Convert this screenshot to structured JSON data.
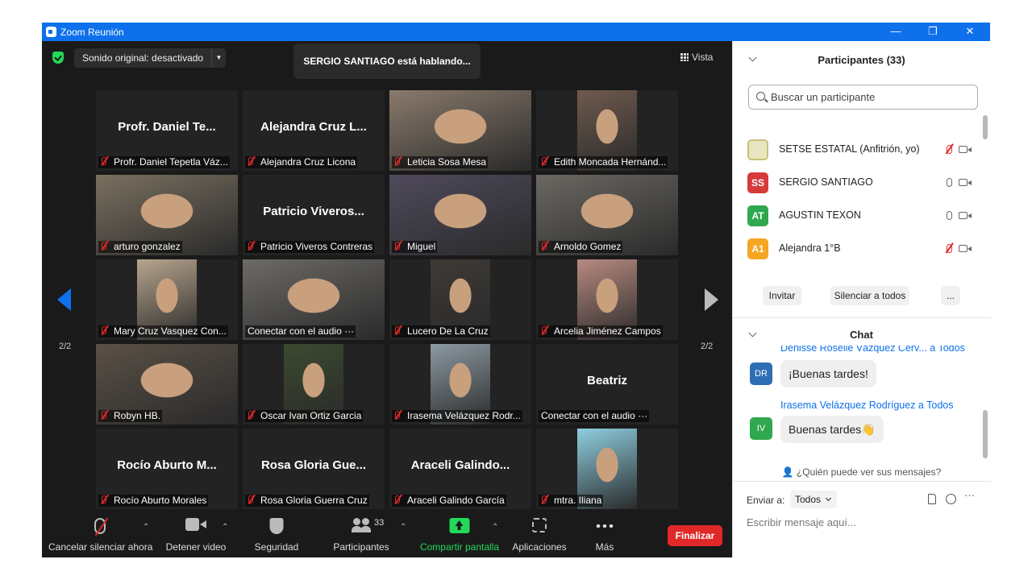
{
  "window": {
    "title": "Zoom Reunión",
    "controls": {
      "minimize": "—",
      "restore": "❐",
      "close": "✕"
    }
  },
  "meeting": {
    "sound_button": "Sonido original: desactivado",
    "speaking_banner": "SERGIO SANTIAGO está hablando...",
    "view_button": "Vista",
    "page_indicator_left": "2/2",
    "page_indicator_right": "2/2",
    "tiles": [
      {
        "big": "Profr. Daniel Te...",
        "name": "Profr. Daniel Tepetla Váz...",
        "muted": true,
        "video": false
      },
      {
        "big": "Alejandra Cruz L...",
        "name": "Alejandra Cruz Licona",
        "muted": true,
        "video": false
      },
      {
        "big": "",
        "name": "Leticia Sosa Mesa",
        "muted": true,
        "video": true,
        "tone": "#8a7a6c"
      },
      {
        "big": "",
        "name": "Edith Moncada Hernánd...",
        "muted": true,
        "video": true,
        "tone": "#6f5a4e"
      },
      {
        "big": "",
        "name": "arturo gonzalez",
        "muted": true,
        "video": true,
        "tone": "#7a7060"
      },
      {
        "big": "Patricio  Viveros...",
        "name": "Patricio Viveros Contreras",
        "muted": true,
        "video": false
      },
      {
        "big": "",
        "name": "Miguel",
        "muted": true,
        "video": true,
        "tone": "#4f4a5c"
      },
      {
        "big": "",
        "name": "Arnoldo Gomez",
        "muted": true,
        "video": true,
        "tone": "#6b6862"
      },
      {
        "big": "",
        "name": "Mary Cruz Vasquez Con...",
        "muted": true,
        "video": true,
        "tone": "#b7a58e"
      },
      {
        "big": "",
        "name": "Conectar con el audio ···",
        "muted": false,
        "video": true,
        "tone": "#6d6a66"
      },
      {
        "big": "",
        "name": "Lucero De La Cruz",
        "muted": true,
        "video": true,
        "tone": "#3e3a36"
      },
      {
        "big": "",
        "name": "Arcelia Jiménez Campos",
        "muted": true,
        "video": true,
        "tone": "#b88a80"
      },
      {
        "big": "",
        "name": "Robyn HB.",
        "muted": true,
        "video": true,
        "tone": "#5a5046"
      },
      {
        "big": "",
        "name": "Oscar Ivan Ortiz Garcia",
        "muted": true,
        "video": true,
        "tone": "#3c4a30"
      },
      {
        "big": "",
        "name": "Irasema Velázquez Rodr...",
        "muted": true,
        "video": true,
        "tone": "#8c9aa2"
      },
      {
        "big": "Beatriz",
        "name": "Conectar con el audio ···",
        "muted": false,
        "video": false
      },
      {
        "big": "Rocío Aburto M...",
        "name": "Rocío Aburto Morales",
        "muted": true,
        "video": false
      },
      {
        "big": "Rosa Gloria Gue...",
        "name": "Rosa Gloria Guerra Cruz",
        "muted": true,
        "video": false
      },
      {
        "big": "Araceli  Galindo...",
        "name": "Araceli Galindo García",
        "muted": true,
        "video": false
      },
      {
        "big": "",
        "name": "mtra. Iliana",
        "muted": true,
        "video": true,
        "tone": "#8ecfe0"
      }
    ]
  },
  "toolbar": {
    "unmute": "Cancelar silenciar ahora",
    "stop_video": "Detener video",
    "security": "Seguridad",
    "participants": "Participantes",
    "participants_count": "33",
    "share": "Compartir pantalla",
    "apps": "Aplicaciones",
    "more": "Más",
    "end": "Finalizar"
  },
  "participants_panel": {
    "title": "Participantes (33)",
    "search_placeholder": "Buscar un participante",
    "list": [
      {
        "initials": "",
        "name": "SETSE ESTATAL (Anfitrión, yo)",
        "color": "#e8e6c0",
        "muted": true
      },
      {
        "initials": "SS",
        "name": "SERGIO SANTIAGO",
        "color": "#d63b3b",
        "muted": false
      },
      {
        "initials": "AT",
        "name": "AGUSTIN TEXON",
        "color": "#2fa84f",
        "muted": false
      },
      {
        "initials": "A1",
        "name": "Alejandra 1°B",
        "color": "#f5a623",
        "muted": true
      }
    ],
    "invite": "Invitar",
    "mute_all": "Silenciar a todos",
    "more": "..."
  },
  "chat_panel": {
    "title": "Chat",
    "messages": [
      {
        "sender": "Denisse Roselle Vázquez Cerv... a Todos",
        "initials": "DR",
        "color": "#2d6fb5",
        "text": "¡Buenas tardes!"
      },
      {
        "sender": "Irasema Velázquez Rodríguez a Todos",
        "initials": "IV",
        "color": "#2fa84f",
        "text": "Buenas tardes👋"
      }
    ],
    "who_can_see": "¿Quién puede ver sus mensajes?",
    "send_to_label": "Enviar a:",
    "send_to_value": "Todos",
    "input_placeholder": "Escribir mensaje aquí..."
  }
}
